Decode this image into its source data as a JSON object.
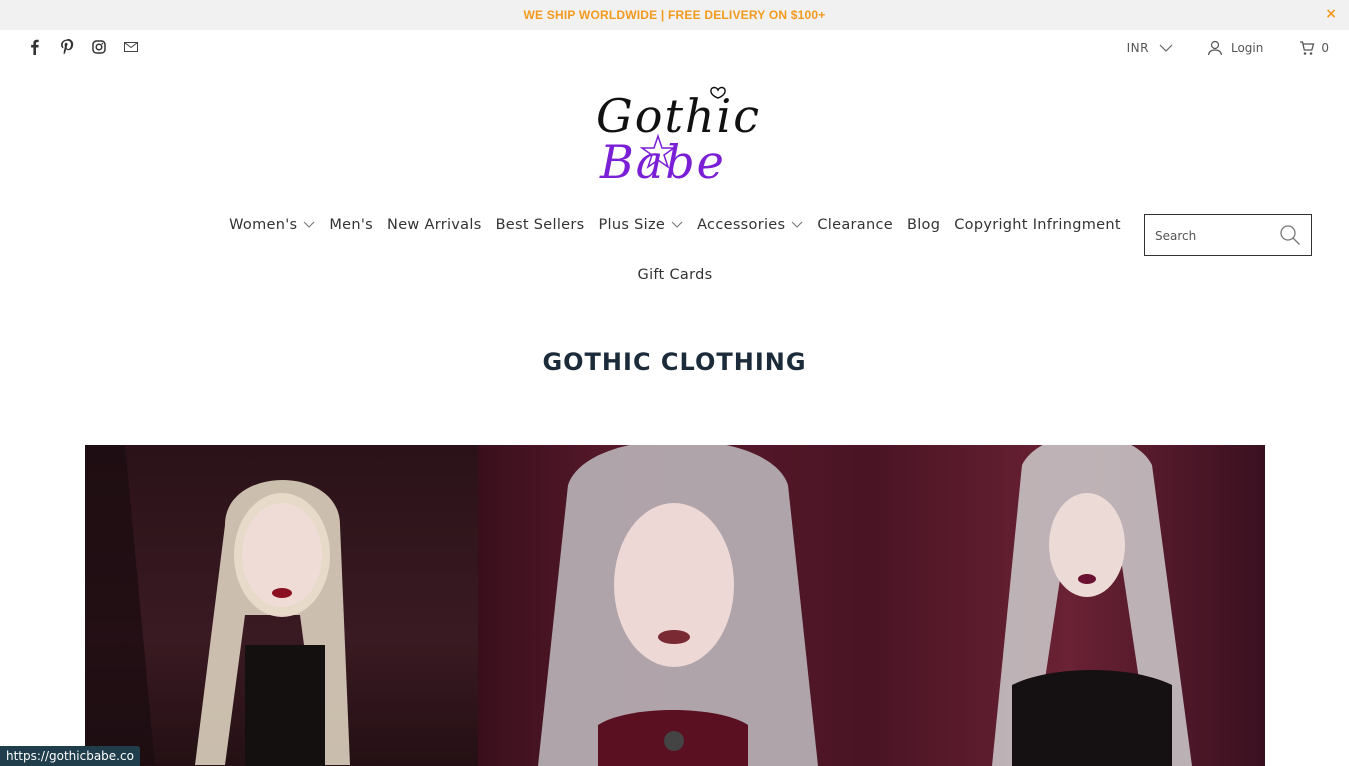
{
  "announcement": {
    "text": "WE SHIP WORLDWIDE | FREE DELIVERY ON $100+",
    "close": "×"
  },
  "header": {
    "social": [
      "facebook-icon",
      "pinterest-icon",
      "instagram-icon",
      "email-icon"
    ],
    "currency": "INR",
    "login": "Login",
    "cart_count": "0"
  },
  "logo": {
    "line1": "Gothic",
    "line2": "Babe"
  },
  "nav": {
    "row1": [
      "Women's",
      "Men's",
      "New Arrivals",
      "Best Sellers",
      "Plus Size",
      "Accessories",
      "Clearance",
      "Blog",
      "Copyright Infringment"
    ],
    "row2": [
      "Gift Cards"
    ]
  },
  "search": {
    "placeholder": "Search"
  },
  "page_title": "GOTHIC CLOTHING",
  "status_bar": "https://gothicbabe.co",
  "colors": {
    "accent": "#f39a1e",
    "title": "#1c2b3a",
    "logo_purple": "#7a1fd6"
  }
}
